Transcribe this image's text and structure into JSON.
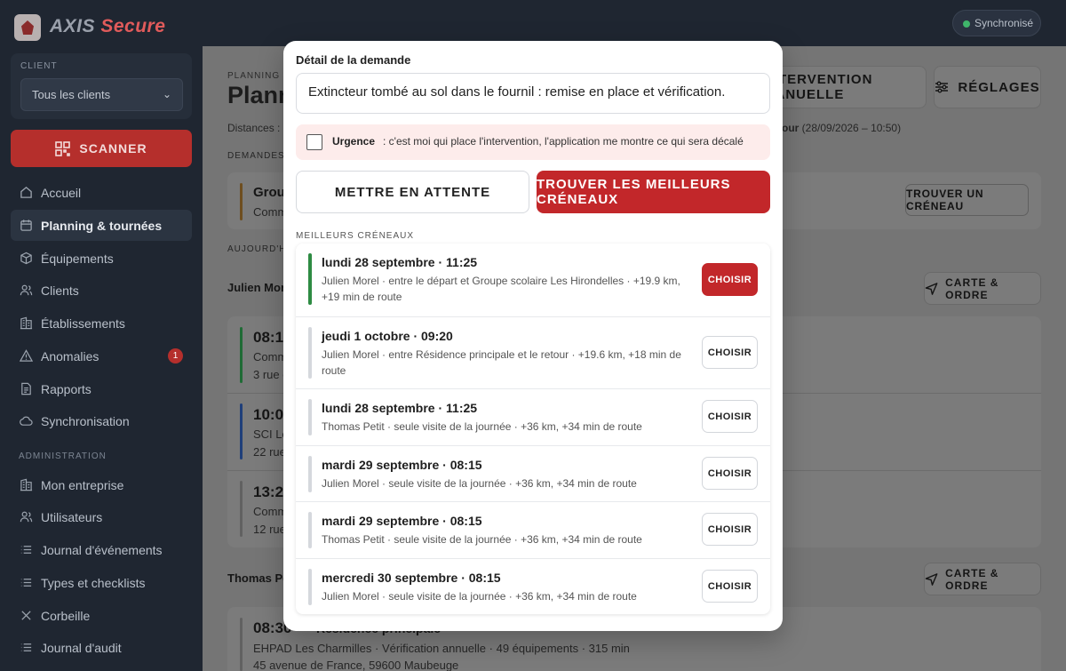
{
  "brand": {
    "name_a": "AXIS",
    "name_b": "Secure"
  },
  "client": {
    "label": "CLIENT",
    "selected": "Tous les clients"
  },
  "scan": {
    "label": "SCANNER"
  },
  "nav": [
    {
      "label": "Accueil",
      "icon": "home-icon"
    },
    {
      "label": "Planning & tournées",
      "icon": "calendar-icon"
    },
    {
      "label": "Équipements",
      "icon": "box-icon"
    },
    {
      "label": "Clients",
      "icon": "users-icon"
    },
    {
      "label": "Établissements",
      "icon": "building-icon"
    },
    {
      "label": "Anomalies",
      "icon": "warning-icon",
      "badge": "1"
    },
    {
      "label": "Rapports",
      "icon": "document-icon"
    },
    {
      "label": "Synchronisation",
      "icon": "cloud-icon"
    }
  ],
  "admin": {
    "label": "ADMINISTRATION",
    "items": [
      {
        "label": "Mon entreprise",
        "icon": "building-icon"
      },
      {
        "label": "Utilisateurs",
        "icon": "users-icon"
      },
      {
        "label": "Journal d'événements",
        "icon": "list-icon"
      },
      {
        "label": "Types et checklists",
        "icon": "list-icon"
      },
      {
        "label": "Corbeille",
        "icon": "close-icon"
      },
      {
        "label": "Journal d'audit",
        "icon": "list-icon"
      }
    ]
  },
  "sync": {
    "label": "Synchronisé"
  },
  "main": {
    "crumb": "PLANNING &",
    "title": "Plannin",
    "dist": "Distances :",
    "retour_bold": "tour",
    "retour_date": "(28/09/2026 – 10:50)",
    "demandes_label": "DEMANDES E",
    "auj_label": "AUJOURD'HUI",
    "manual_btn": "INTERVENTION MANUELLE",
    "settings_btn": "RÉGLAGES",
    "demande_title": "Group",
    "demande_sub": "Comm",
    "find_slot_btn": "TROUVER UN CRÉNEAU",
    "tech1": "Julien More",
    "tech2": "Thomas Pet",
    "map_btn": "CARTE & ORDRE",
    "visits": [
      {
        "time": "08:15",
        "sub": "Comm",
        "addr": "3 rue c"
      },
      {
        "time": "10:00",
        "sub": "SCI Le",
        "addr": "22 rue"
      },
      {
        "time": "13:25",
        "sub": "Comm",
        "addr": "12 rue"
      }
    ],
    "bottom_visit": {
      "time": "08:30",
      "title": "Résidence principale",
      "details": "EHPAD Les Charmilles · Vérification annuelle · 49 équipements · 315 min",
      "addr": "45 avenue de France, 59600 Maubeuge"
    }
  },
  "modal": {
    "label": "Détail de la demande",
    "text": "Extincteur tombé au sol dans le fournil : remise en place et vérification.",
    "urgence_title": "Urgence",
    "urgence_desc": ": c'est moi qui place l'intervention, l'application me montre ce qui sera décalé",
    "wait_btn": "METTRE EN ATTENTE",
    "find_btn": "TROUVER LES MEILLEURS CRÉNEAUX",
    "best_label": "MEILLEURS CRÉNEAUX",
    "choose_label": "CHOISIR",
    "slots": [
      {
        "title": "lundi 28 septembre · 11:25",
        "desc": "Julien Morel · entre le départ et Groupe scolaire Les Hirondelles · +19.9 km, +19 min de route"
      },
      {
        "title": "jeudi 1 octobre · 09:20",
        "desc": "Julien Morel · entre Résidence principale et le retour · +19.6 km, +18 min de route"
      },
      {
        "title": "lundi 28 septembre · 11:25",
        "desc": "Thomas Petit · seule visite de la journée · +36 km, +34 min de route"
      },
      {
        "title": "mardi 29 septembre · 08:15",
        "desc": "Julien Morel · seule visite de la journée · +36 km, +34 min de route"
      },
      {
        "title": "mardi 29 septembre · 08:15",
        "desc": "Thomas Petit · seule visite de la journée · +36 km, +34 min de route"
      },
      {
        "title": "mercredi 30 septembre · 08:15",
        "desc": "Julien Morel · seule visite de la journée · +36 km, +34 min de route"
      }
    ]
  },
  "colors": {
    "accent": "#c2272a",
    "sidebar": "#1f2631",
    "best": "#2e8b43",
    "sync_dot": "#3fb56a"
  }
}
